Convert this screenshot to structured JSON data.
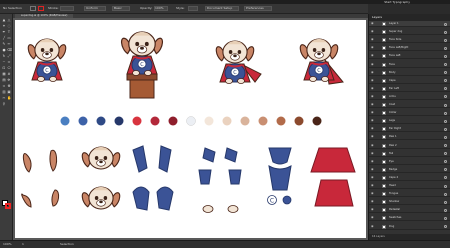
{
  "app": {
    "title": "Start Typography"
  },
  "control_bar": {
    "selection_label": "No Selection",
    "stroke_label": "Stroke:",
    "stroke_value": "",
    "uniform_label": "Uniform",
    "brush_label": "Basic",
    "opacity_label": "Opacity:",
    "opacity_value": "100%",
    "style_label": "Style:",
    "doc_setup_label": "Document Setup",
    "preferences_label": "Preferences",
    "fill_color": "#ffffff",
    "stroke_color": "#e22222"
  },
  "document": {
    "tab_label": "superdog.ai @ 100% (RGB/Preview)"
  },
  "tools": [
    "arrow",
    "direct",
    "magic",
    "lasso",
    "pen",
    "type",
    "line",
    "rect",
    "brush",
    "pencil",
    "blob",
    "eraser",
    "rotate",
    "scale",
    "warp",
    "width",
    "free",
    "shape",
    "perspective",
    "mesh",
    "gradient",
    "eyedropper",
    "blend",
    "symbol",
    "graph",
    "artboard",
    "slice",
    "hand",
    "zoom"
  ],
  "palette": [
    "#4a7fc1",
    "#3d62a8",
    "#2f4a86",
    "#26386a",
    "#d8343f",
    "#b3283a",
    "#8f1e2c",
    "#eceff4",
    "#f3e6da",
    "#ead2bf",
    "#d9b39b",
    "#c98f72",
    "#b26b4a",
    "#8c4a2e",
    "#4a2518"
  ],
  "layers": {
    "title": "Layers",
    "footer": "16 Layers",
    "items": [
      "Layer 1",
      "Super dog",
      "Face Side",
      "Face Left/Right",
      "Face Left",
      "Face",
      "Body",
      "Cape",
      "Ear Left",
      "Arms",
      "Coat",
      "Collar",
      "Legs",
      "Ear Right",
      "Paw 1",
      "Paw 2",
      "Tail",
      "Eye",
      "Badge",
      "Cape 2",
      "Head",
      "Tongue",
      "Shadow",
      "Pedestal",
      "Swatches",
      "Dog"
    ]
  },
  "status": {
    "zoom": "100%",
    "page": "1",
    "tool": "Selection"
  }
}
